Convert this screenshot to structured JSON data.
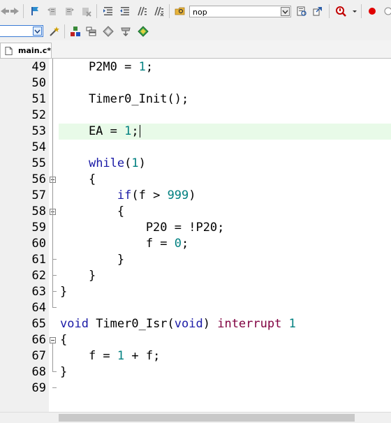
{
  "toolbar": {
    "find_combo_value": "nop",
    "target_combo_value": ""
  },
  "tabs": [
    {
      "label": "main.c*"
    }
  ],
  "editor": {
    "active_line": 53,
    "lines": [
      {
        "num": "49",
        "text": "    P2M0 = 1;"
      },
      {
        "num": "50",
        "text": ""
      },
      {
        "num": "51",
        "text": "    Timer0_Init();"
      },
      {
        "num": "52",
        "text": ""
      },
      {
        "num": "53",
        "text": "    EA = 1;"
      },
      {
        "num": "54",
        "text": ""
      },
      {
        "num": "55",
        "text": "    while(1)"
      },
      {
        "num": "56",
        "text": "    {"
      },
      {
        "num": "57",
        "text": "        if(f > 999)"
      },
      {
        "num": "58",
        "text": "        {"
      },
      {
        "num": "59",
        "text": "            P20 = !P20;"
      },
      {
        "num": "60",
        "text": "            f = 0;"
      },
      {
        "num": "61",
        "text": "        }"
      },
      {
        "num": "62",
        "text": "    }"
      },
      {
        "num": "63",
        "text": "}"
      },
      {
        "num": "64",
        "text": ""
      },
      {
        "num": "65",
        "text": "void Timer0_Isr(void) interrupt 1"
      },
      {
        "num": "66",
        "text": "{"
      },
      {
        "num": "67",
        "text": "    f = 1 + f;"
      },
      {
        "num": "68",
        "text": "}"
      },
      {
        "num": "69",
        "text": ""
      }
    ]
  },
  "colors": {
    "keyword": "#1a1aa6",
    "number": "#008080",
    "interrupt_keyword": "#800040",
    "active_line_bg": "#e8fae8",
    "gutter_bg": "#f0f0f0"
  },
  "icons": [
    "back-arrow-icon",
    "forward-arrow-icon",
    "bookmark-set-icon",
    "bookmark-prev-icon",
    "bookmark-next-icon",
    "bookmark-clear-icon",
    "indent-icon",
    "unindent-icon",
    "comment-icon",
    "uncomment-icon",
    "find-in-files-icon",
    "find-dropdown-icon",
    "incremental-find-icon",
    "debug-icon",
    "breakpoint-icon",
    "build-target-icon",
    "magic-wand-icon",
    "manage-components-icon",
    "file-extensions-icon",
    "books-icon",
    "pack-installer-icon",
    "file-c-icon"
  ]
}
